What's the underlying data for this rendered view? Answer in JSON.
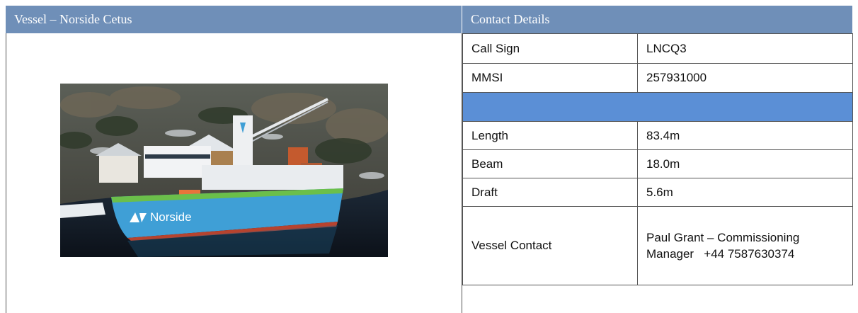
{
  "vessel_header": "Vessel – Norside Cetus",
  "contact_header": "Contact Details",
  "photo": {
    "hull_text": "Norside"
  },
  "specs": {
    "call_sign_label": "Call Sign",
    "call_sign_value": "LNCQ3",
    "mmsi_label": "MMSI",
    "mmsi_value": "257931000",
    "length_label": "Length",
    "length_value": "83.4m",
    "beam_label": "Beam",
    "beam_value": "18.0m",
    "draft_label": "Draft",
    "draft_value": "5.6m",
    "contact_label": "Vessel Contact",
    "contact_value": "Paul Grant – Commissioning Manager   +44 7587630374"
  },
  "colors": {
    "header_bg": "#6f8fb8",
    "band_bg": "#5b8fd6",
    "hull_blue": "#3f9fd6"
  }
}
